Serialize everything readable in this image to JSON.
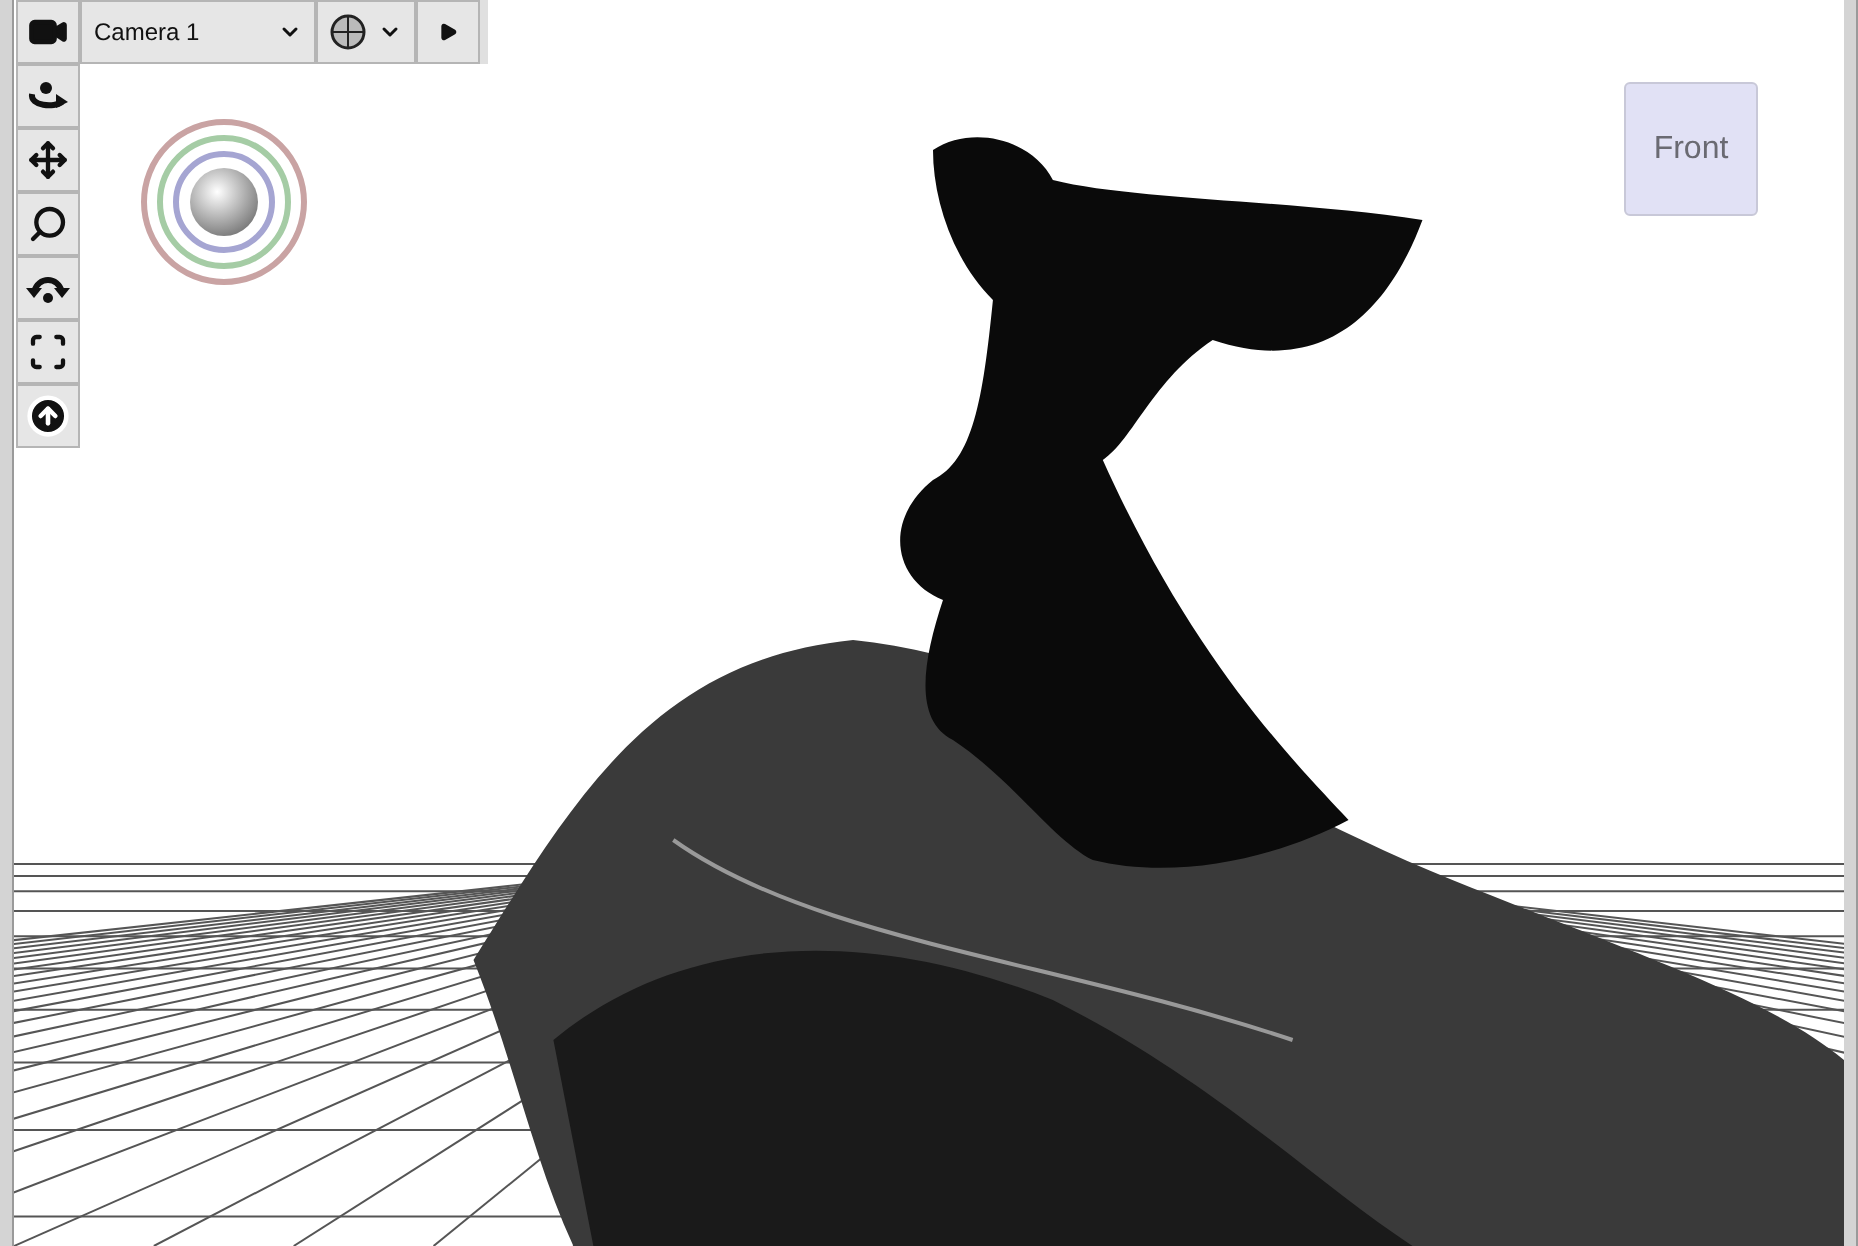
{
  "camera_menu": {
    "label": "Camera 1"
  },
  "view_cube": {
    "label": "Front"
  }
}
